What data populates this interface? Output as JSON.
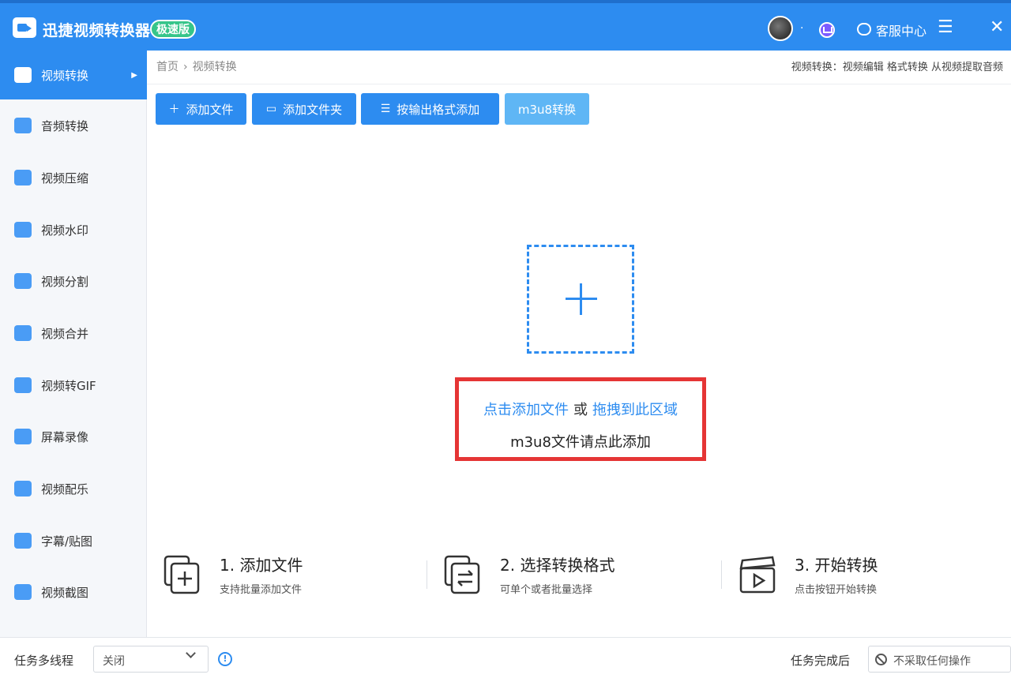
{
  "app": {
    "title": "迅捷视频转换器",
    "badge": "极速版",
    "service_label": "客服中心"
  },
  "sidebar": {
    "items": [
      {
        "label": "视频转换",
        "active": true
      },
      {
        "label": "音频转换"
      },
      {
        "label": "视频压缩"
      },
      {
        "label": "视频水印"
      },
      {
        "label": "视频分割"
      },
      {
        "label": "视频合并"
      },
      {
        "label": "视频转GIF"
      },
      {
        "label": "屏幕录像"
      },
      {
        "label": "视频配乐"
      },
      {
        "label": "字幕/贴图"
      },
      {
        "label": "视频截图"
      }
    ]
  },
  "breadcrumb": {
    "home": "首页",
    "current": "视频转换"
  },
  "header_desc": "视频转换：视频编辑 格式转换 从视频提取音频",
  "toolbar": {
    "add_file": "添加文件",
    "add_folder": "添加文件夹",
    "add_by_format": "按输出格式添加",
    "m3u8": "m3u8转换"
  },
  "drop": {
    "click_add": "点击添加文件",
    "or": "或",
    "drag_here": "拖拽到此区域",
    "m3u8_hint": "m3u8文件请点此添加"
  },
  "steps": [
    {
      "title": "1. 添加文件",
      "sub": "支持批量添加文件"
    },
    {
      "title": "2. 选择转换格式",
      "sub": "可单个或者批量选择"
    },
    {
      "title": "3. 开始转换",
      "sub": "点击按钮开始转换"
    }
  ],
  "footer": {
    "multithread_label": "任务多线程",
    "multithread_value": "关闭",
    "after_label": "任务完成后",
    "after_value": "不采取任何操作"
  }
}
